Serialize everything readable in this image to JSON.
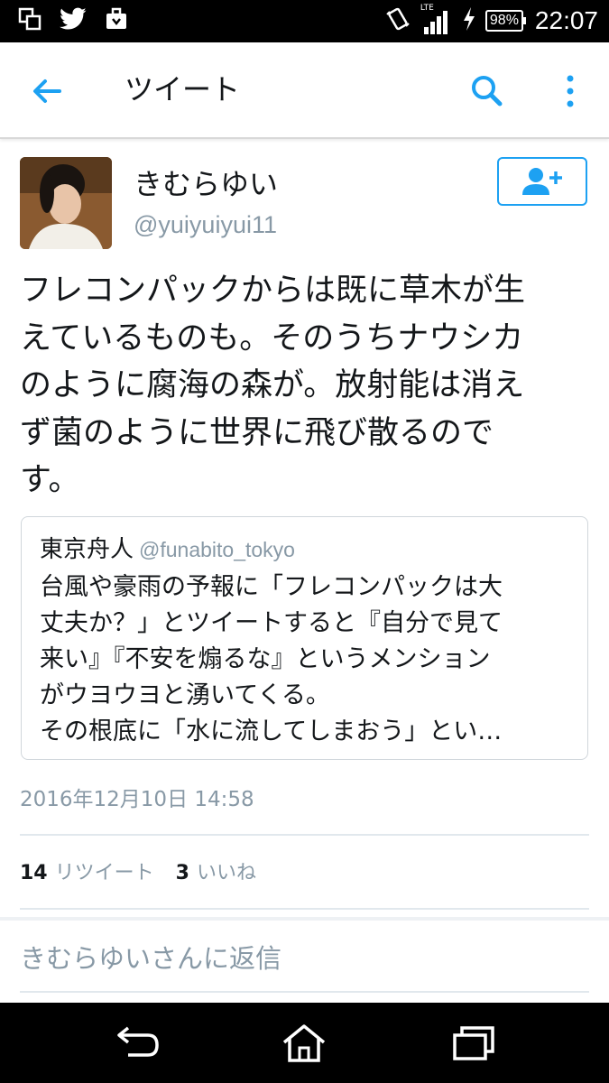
{
  "status_bar": {
    "time": "22:07",
    "battery": "98%",
    "network": "LTE",
    "icons": [
      "multiwindow-icon",
      "twitter-icon",
      "briefcase-icon",
      "vibrate-icon",
      "signal-icon",
      "charging-icon",
      "battery-icon"
    ]
  },
  "app_bar": {
    "title": "ツイート",
    "accent_color": "#1da1f2",
    "icons": [
      "back-arrow-icon",
      "search-icon",
      "more-vert-icon"
    ]
  },
  "tweet": {
    "author_name": "きむらゆい",
    "author_handle": "@yuiyuiyui11",
    "follow_icon": "add-user-icon",
    "text": "フレコンパックからは既に草木が生\nえているものも。そのうちナウシカ\nのように腐海の森が。放射能は消え\nず菌のように世界に飛び散るので\nす。",
    "timestamp": "2016年12月10日 14:58",
    "retweet_count": "14",
    "retweet_label": "リツイート",
    "like_count": "3",
    "like_label": "いいね"
  },
  "quoted_tweet": {
    "author_name": "東京舟人",
    "author_handle": "@funabito_tokyo",
    "text": "台風や豪雨の予報に「フレコンパックは大\n丈夫か？」とツイートすると『自分で見て\n来い』『不安を煽るな』というメンション\nがウヨウヨと湧いてくる。\nその根底に「水に流してしまおう」とい…"
  },
  "reply": {
    "placeholder": "きむらゆいさんに返信"
  },
  "nav_bar": {
    "icons": [
      "back-nav-icon",
      "home-nav-icon",
      "recents-nav-icon"
    ]
  }
}
